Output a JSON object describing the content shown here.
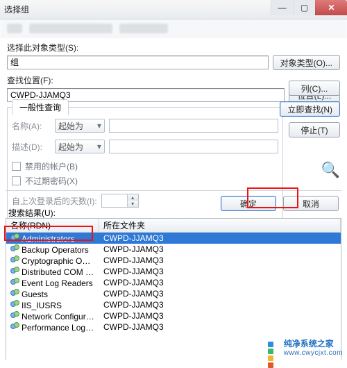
{
  "window": {
    "title": "选择组"
  },
  "section_object_type": {
    "label": "选择此对象类型(S):",
    "value": "组",
    "button": "对象类型(O)..."
  },
  "section_location": {
    "label": "查找位置(F):",
    "value": "CWPD-JJAMQ3",
    "button": "位置(L)..."
  },
  "general_query": {
    "tab": "一般性查询",
    "name_label": "名称(A):",
    "desc_label": "描述(D):",
    "combo_value": "起始为",
    "chk_disabled": "禁用的帐户(B)",
    "chk_no_expire": "不过期密码(X)",
    "days_label": "自上次登录后的天数(I):"
  },
  "side_buttons": {
    "columns": "列(C)...",
    "find_now": "立即查找(N)",
    "stop": "停止(T)"
  },
  "dialog_buttons": {
    "ok": "确定",
    "cancel": "取消"
  },
  "results": {
    "label": "搜索结果(U):",
    "columns": {
      "name": "名称(RDN)",
      "folder": "所在文件夹"
    },
    "rows": [
      {
        "name": "Administrators",
        "folder": "CWPD-JJAMQ3",
        "selected": true
      },
      {
        "name": "Backup Operators",
        "folder": "CWPD-JJAMQ3",
        "selected": false
      },
      {
        "name": "Cryptographic Ope...",
        "folder": "CWPD-JJAMQ3",
        "selected": false
      },
      {
        "name": "Distributed COM U...",
        "folder": "CWPD-JJAMQ3",
        "selected": false
      },
      {
        "name": "Event Log Readers",
        "folder": "CWPD-JJAMQ3",
        "selected": false
      },
      {
        "name": "Guests",
        "folder": "CWPD-JJAMQ3",
        "selected": false
      },
      {
        "name": "IIS_IUSRS",
        "folder": "CWPD-JJAMQ3",
        "selected": false
      },
      {
        "name": "Network Configura...",
        "folder": "CWPD-JJAMQ3",
        "selected": false
      },
      {
        "name": "Performance Log U...",
        "folder": "CWPD-JJAMQ3",
        "selected": false
      }
    ]
  },
  "watermark": {
    "brand": "纯净系统之家",
    "url": "www.cwycjxt.com"
  }
}
